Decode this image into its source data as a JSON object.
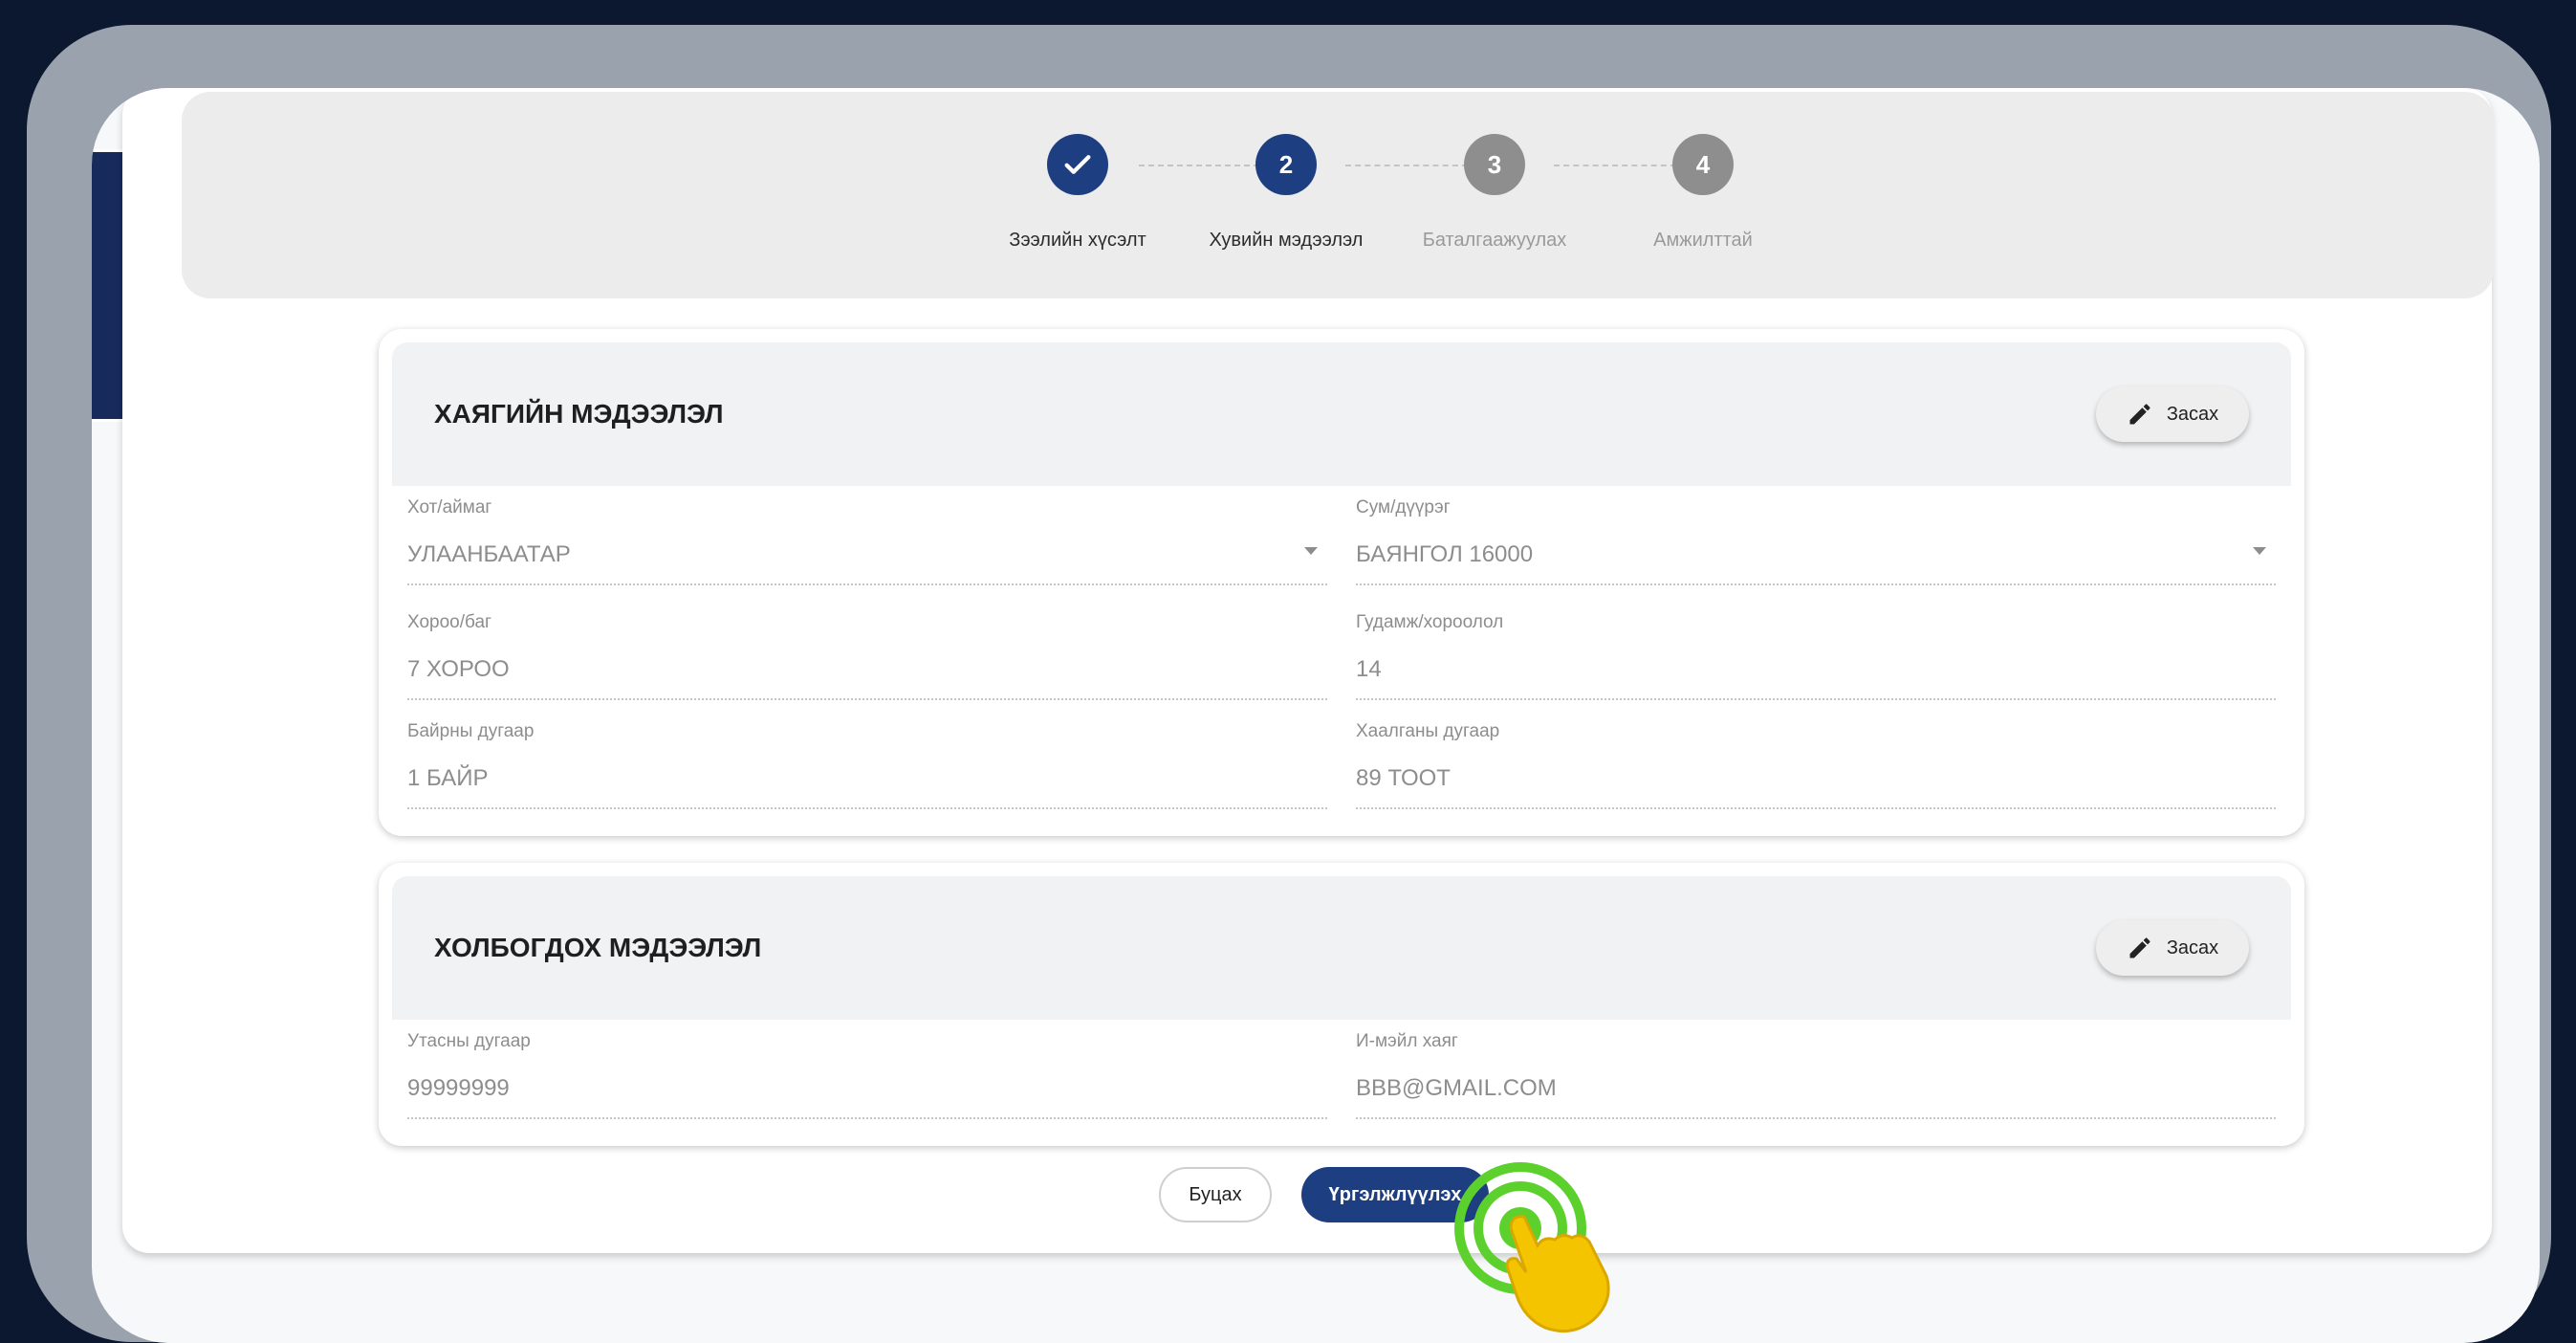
{
  "stepper": {
    "steps": [
      {
        "number": "",
        "label": "Зээлийн хүсэлт",
        "state": "completed"
      },
      {
        "number": "2",
        "label": "Хувийн мэдээлэл",
        "state": "active"
      },
      {
        "number": "3",
        "label": "Баталгаажуулах",
        "state": "pending"
      },
      {
        "number": "4",
        "label": "Амжилттай",
        "state": "pending"
      }
    ]
  },
  "address": {
    "title": "ХАЯГИЙН МЭДЭЭЛЭЛ",
    "edit_label": "Засах",
    "fields": {
      "city": {
        "label": "Хот/аймаг",
        "value": "УЛААНБААТАР"
      },
      "district": {
        "label": "Сум/дүүрэг",
        "value": "БАЯНГОЛ 16000"
      },
      "khoroo": {
        "label": "Хороо/баг",
        "value": "7 ХОРОО"
      },
      "street": {
        "label": "Гудамж/хороолол",
        "value": "14"
      },
      "building": {
        "label": "Байрны дугаар",
        "value": "1 БАЙР"
      },
      "door": {
        "label": "Хаалганы дугаар",
        "value": "89 ТООТ"
      }
    }
  },
  "contact": {
    "title": "ХОЛБОГДОХ МЭДЭЭЛЭЛ",
    "edit_label": "Засах",
    "fields": {
      "phone": {
        "label": "Утасны дугаар",
        "value": "99999999"
      },
      "email": {
        "label": "И-мэйл хаяг",
        "value": "BBB@GMAIL.COM"
      }
    }
  },
  "actions": {
    "back_label": "Буцах",
    "next_label": "Үргэлжлүүлэх"
  },
  "colors": {
    "primary": "#1d3e80",
    "pending": "#8e8e8e",
    "tap_indicator": "#5cd02c",
    "hand": "#f5c400"
  },
  "icons": {
    "check": "check-icon",
    "edit": "pencil-icon",
    "tap": "tap-hand-icon"
  }
}
